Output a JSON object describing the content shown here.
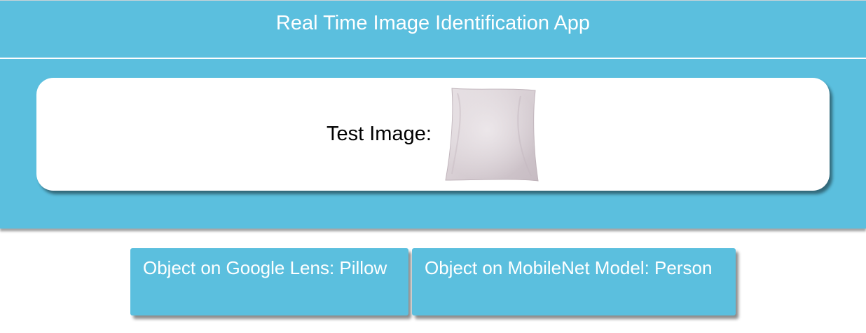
{
  "header": {
    "title": "Real Time Image Identification App"
  },
  "test_card": {
    "label": "Test Image:",
    "image_icon": "pillow-image"
  },
  "results": {
    "google_lens": "Object on Google Lens: Pillow",
    "mobilenet": "Object on MobileNet Model: Person"
  },
  "colors": {
    "primary": "#5bbfde",
    "card_bg": "#ffffff",
    "text_on_primary": "#ffffff"
  }
}
